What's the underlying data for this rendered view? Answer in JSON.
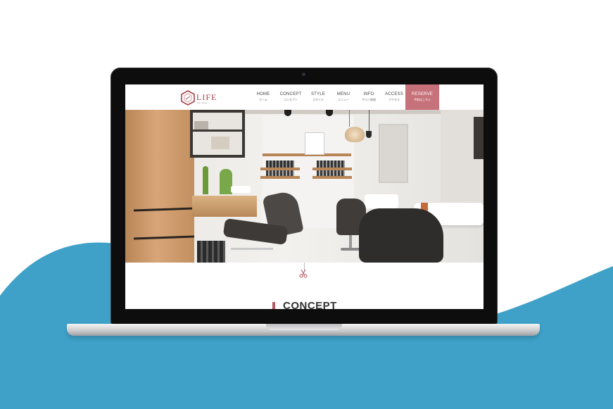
{
  "brand": {
    "name": "LIFE",
    "tagline": "hair design",
    "accent": "#a3424c"
  },
  "nav": {
    "items": [
      {
        "label": "HOME",
        "sub": "ホーム"
      },
      {
        "label": "CONCEPT",
        "sub": "コンセプト"
      },
      {
        "label": "STYLE",
        "sub": "スタイル"
      },
      {
        "label": "MENU",
        "sub": "メニュー"
      },
      {
        "label": "INFO",
        "sub": "サロン情報"
      },
      {
        "label": "ACCESS",
        "sub": "アクセス"
      }
    ],
    "reserve": {
      "label": "RESERVE",
      "sub": "予約はこちら",
      "color": "#c7727a"
    }
  },
  "hero": {
    "icon": "scissors-icon"
  },
  "section": {
    "title": "CONCEPT"
  },
  "colors": {
    "wave": "#3fa1c8",
    "background": "#ffffff"
  }
}
